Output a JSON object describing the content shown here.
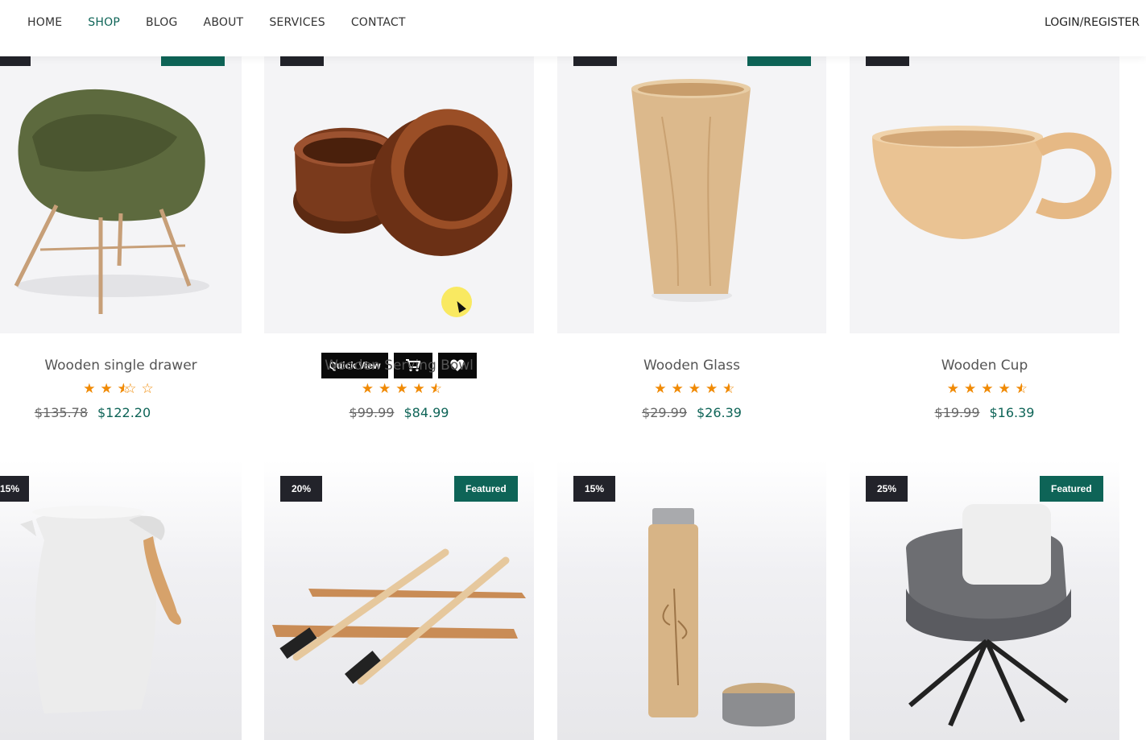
{
  "nav": {
    "items": [
      "HOME",
      "SHOP",
      "BLOG",
      "ABOUT",
      "SERVICES",
      "CONTACT"
    ],
    "active": "SHOP",
    "login": "LOGIN/REGISTER"
  },
  "colors": {
    "accent": "#0e6457",
    "badge_dark": "#22232a",
    "star": "#f08a05"
  },
  "overlay": {
    "quick_view": "Quick View",
    "cart_icon": "cart-icon",
    "heart_icon": "heart-icon"
  },
  "products_row1": [
    {
      "name": "Wooden single drawer",
      "rating": 2.5,
      "old_price": "$135.78",
      "price": "$122.20",
      "image": "green-lounge-chair"
    },
    {
      "name": "Wooden Serving Bowl",
      "rating": 4.5,
      "old_price": "$99.99",
      "price": "$84.99",
      "image": "wooden-bowls"
    },
    {
      "name": "Wooden Glass",
      "rating": 4.5,
      "old_price": "$29.99",
      "price": "$26.39",
      "image": "wooden-cup-tall"
    },
    {
      "name": "Wooden Cup",
      "rating": 4.5,
      "old_price": "$19.99",
      "price": "$16.39",
      "image": "wooden-mug"
    }
  ],
  "products_row2": [
    {
      "discount": "15%",
      "featured": "",
      "image": "white-pitcher"
    },
    {
      "discount": "20%",
      "featured": "Featured",
      "image": "bamboo-toothbrushes"
    },
    {
      "discount": "15%",
      "featured": "",
      "image": "bamboo-flask"
    },
    {
      "discount": "25%",
      "featured": "Featured",
      "image": "grey-armchair"
    }
  ]
}
